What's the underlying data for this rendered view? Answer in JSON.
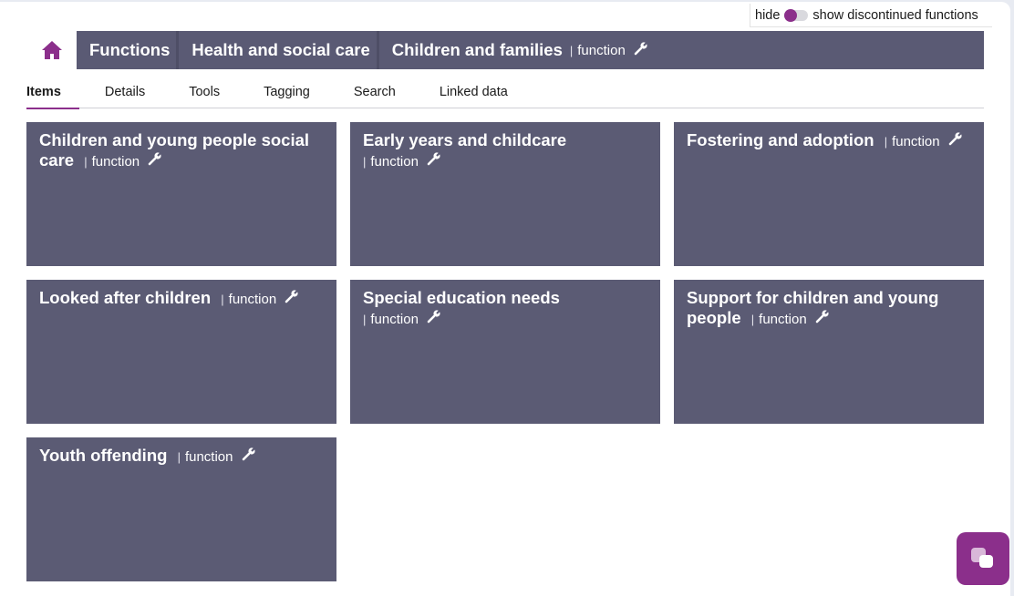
{
  "toggle": {
    "hide_label": "hide",
    "show_label": "show discontinued functions"
  },
  "breadcrumb": {
    "items": [
      {
        "label": "Functions"
      },
      {
        "label": "Health and social care"
      },
      {
        "label": "Children and families",
        "type": "function"
      }
    ],
    "pipe": "|"
  },
  "tabs": [
    {
      "label": "Items",
      "active": true
    },
    {
      "label": "Details"
    },
    {
      "label": "Tools"
    },
    {
      "label": "Tagging"
    },
    {
      "label": "Search"
    },
    {
      "label": "Linked data"
    }
  ],
  "cards": [
    {
      "title": "Children and young people social care",
      "type": "function"
    },
    {
      "title": "Early years and childcare",
      "type": "function"
    },
    {
      "title": "Fostering and adoption",
      "type": "function"
    },
    {
      "title": "Looked after children",
      "type": "function"
    },
    {
      "title": "Special education needs",
      "type": "function"
    },
    {
      "title": "Support for children and young people",
      "type": "function"
    },
    {
      "title": "Youth offending",
      "type": "function"
    }
  ],
  "colors": {
    "accent": "#8b2f8b",
    "card_bg": "#5b5b74",
    "breadcrumb_bg": "#5a5a74"
  },
  "icons": {
    "home": "home-icon",
    "wrench": "wrench-icon",
    "chat": "chat-icon"
  }
}
